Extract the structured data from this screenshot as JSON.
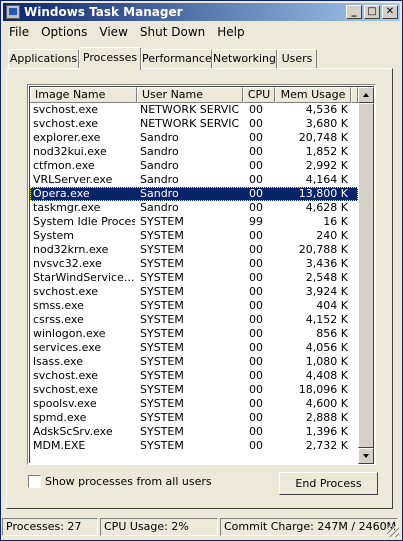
{
  "window": {
    "title": "Windows Task Manager"
  },
  "titlebar": {
    "minimize": "_",
    "maximize": "□",
    "close": "✕"
  },
  "menu": [
    "File",
    "Options",
    "View",
    "Shut Down",
    "Help"
  ],
  "tabs": [
    "Applications",
    "Processes",
    "Performance",
    "Networking",
    "Users"
  ],
  "active_tab": "Processes",
  "columns": {
    "name": "Image Name",
    "user": "User Name",
    "cpu": "CPU",
    "mem": "Mem Usage"
  },
  "processes": [
    {
      "name": "svchost.exe",
      "user": "NETWORK SERVICE",
      "cpu": "00",
      "mem": "4,536 K"
    },
    {
      "name": "svchost.exe",
      "user": "NETWORK SERVICE",
      "cpu": "00",
      "mem": "3,680 K"
    },
    {
      "name": "explorer.exe",
      "user": "Sandro",
      "cpu": "00",
      "mem": "20,748 K"
    },
    {
      "name": "nod32kui.exe",
      "user": "Sandro",
      "cpu": "00",
      "mem": "1,852 K"
    },
    {
      "name": "ctfmon.exe",
      "user": "Sandro",
      "cpu": "00",
      "mem": "2,992 K"
    },
    {
      "name": "VRLServer.exe",
      "user": "Sandro",
      "cpu": "00",
      "mem": "4,164 K"
    },
    {
      "name": "Opera.exe",
      "user": "Sandro",
      "cpu": "00",
      "mem": "13,800 K"
    },
    {
      "name": "taskmgr.exe",
      "user": "Sandro",
      "cpu": "00",
      "mem": "4,628 K"
    },
    {
      "name": "System Idle Process",
      "user": "SYSTEM",
      "cpu": "99",
      "mem": "16 K"
    },
    {
      "name": "System",
      "user": "SYSTEM",
      "cpu": "00",
      "mem": "240 K"
    },
    {
      "name": "nod32krn.exe",
      "user": "SYSTEM",
      "cpu": "00",
      "mem": "20,788 K"
    },
    {
      "name": "nvsvc32.exe",
      "user": "SYSTEM",
      "cpu": "00",
      "mem": "3,436 K"
    },
    {
      "name": "StarWindService....",
      "user": "SYSTEM",
      "cpu": "00",
      "mem": "2,548 K"
    },
    {
      "name": "svchost.exe",
      "user": "SYSTEM",
      "cpu": "00",
      "mem": "3,924 K"
    },
    {
      "name": "smss.exe",
      "user": "SYSTEM",
      "cpu": "00",
      "mem": "404 K"
    },
    {
      "name": "csrss.exe",
      "user": "SYSTEM",
      "cpu": "00",
      "mem": "4,152 K"
    },
    {
      "name": "winlogon.exe",
      "user": "SYSTEM",
      "cpu": "00",
      "mem": "856 K"
    },
    {
      "name": "services.exe",
      "user": "SYSTEM",
      "cpu": "00",
      "mem": "4,056 K"
    },
    {
      "name": "lsass.exe",
      "user": "SYSTEM",
      "cpu": "00",
      "mem": "1,080 K"
    },
    {
      "name": "svchost.exe",
      "user": "SYSTEM",
      "cpu": "00",
      "mem": "4,408 K"
    },
    {
      "name": "svchost.exe",
      "user": "SYSTEM",
      "cpu": "00",
      "mem": "18,096 K"
    },
    {
      "name": "spoolsv.exe",
      "user": "SYSTEM",
      "cpu": "00",
      "mem": "4,600 K"
    },
    {
      "name": "spmd.exe",
      "user": "SYSTEM",
      "cpu": "00",
      "mem": "2,888 K"
    },
    {
      "name": "AdskScSrv.exe",
      "user": "SYSTEM",
      "cpu": "00",
      "mem": "1,396 K"
    },
    {
      "name": "MDM.EXE",
      "user": "SYSTEM",
      "cpu": "00",
      "mem": "2,732 K"
    }
  ],
  "selected_index": 6,
  "show_all_users": {
    "label": "Show processes from all users",
    "checked": false
  },
  "end_process_label": "End Process",
  "status": {
    "processes": "Processes: 27",
    "cpu": "CPU Usage: 2%",
    "commit": "Commit Charge: 247M / 2460M"
  },
  "colors": {
    "selection": "#0a246a",
    "titlebar_start": "#0a246a",
    "titlebar_end": "#a6caf0",
    "face": "#ece9d8"
  }
}
